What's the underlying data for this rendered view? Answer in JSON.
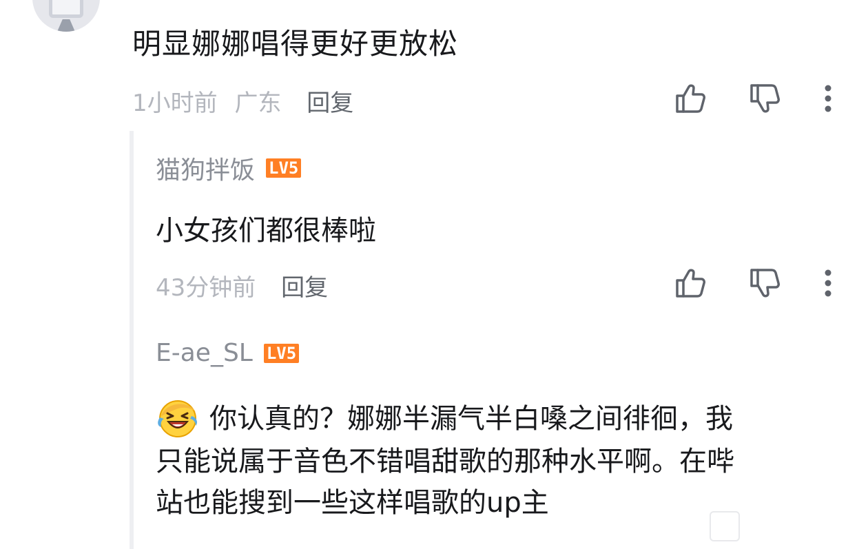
{
  "comment": {
    "text": "明显娜娜唱得更好更放松",
    "time": "1小时前",
    "location": "广东",
    "reply_label": "回复"
  },
  "replies": [
    {
      "username": "猫狗拌饭",
      "level": "LV5",
      "text": "小女孩们都很棒啦",
      "time": "43分钟前",
      "reply_label": "回复"
    },
    {
      "username": "E-ae_SL",
      "level": "LV5",
      "emoji": "laughing-crying-emoji",
      "lines": [
        "你认真的？娜娜半漏气半白嗓之间徘徊，我",
        "只能说属于音色不错唱甜歌的那种水平啊。在哔",
        "站也能搜到一些这样唱歌的up主"
      ]
    }
  ],
  "icons": {
    "like": "thumbs-up-icon",
    "dislike": "thumbs-down-icon",
    "more": "more-vertical-icon"
  },
  "colors": {
    "level_badge": "#ff7f24",
    "text": "#18191c",
    "muted": "#b3b6bd"
  }
}
